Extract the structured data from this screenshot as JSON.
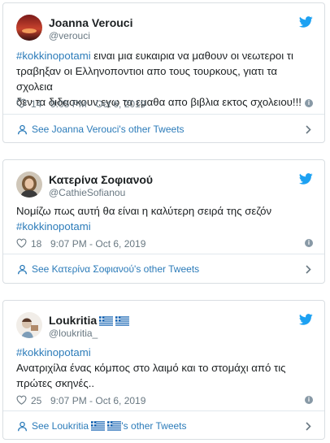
{
  "colors": {
    "hashtag": "#2b7bb9",
    "twitter_blue": "#1da1f2",
    "muted": "#697882"
  },
  "tweets": [
    {
      "name": "Joanna Verouci",
      "handle": "@verouci",
      "hashtag": "#kokkinopotami",
      "text_after_hashtag": " ειναι μια ευκαιρια να μαθουν οι νεωτεροι τι",
      "line2": "τραβηξαν οι Ελληνοποντιοι απο τους τουρκους, γιατι τα σχολεια",
      "line3": "δεν τα διδασκουν.εγω τα εμαθα απο βιβλια εκτος σχολειου!!!",
      "likes": "14",
      "time": "9:05 PM - Oct 6, 2019",
      "footer": "See Joanna Verouci's other Tweets",
      "avatar": "sunset-avatar"
    },
    {
      "name": "Κατερίνα Σοφιανού",
      "handle": "@CathieSofianou",
      "line1": "Νομίζω πως αυτή θα είναι η καλύτερη σειρά της σεζόν",
      "hashtag": "#kokkinopotami",
      "likes": "18",
      "time": "9:07 PM - Oct 6, 2019",
      "footer": "See Κατερίνα Σοφιανού's other Tweets",
      "avatar": "portrait-avatar"
    },
    {
      "name": "Loukritia",
      "handle": "@loukritia_",
      "hashtag": "#kokkinopotami",
      "line1": "Ανατριχίλα ένας κόμπος στο λαιμό και το στομάχι από τις",
      "line2": "πρώτες σκηνές..",
      "likes": "25",
      "time": "9:07 PM - Oct 6, 2019",
      "footer_prefix": "See Loukritia ",
      "footer_suffix": "'s other Tweets",
      "avatar": "cartoon-avatar"
    }
  ]
}
